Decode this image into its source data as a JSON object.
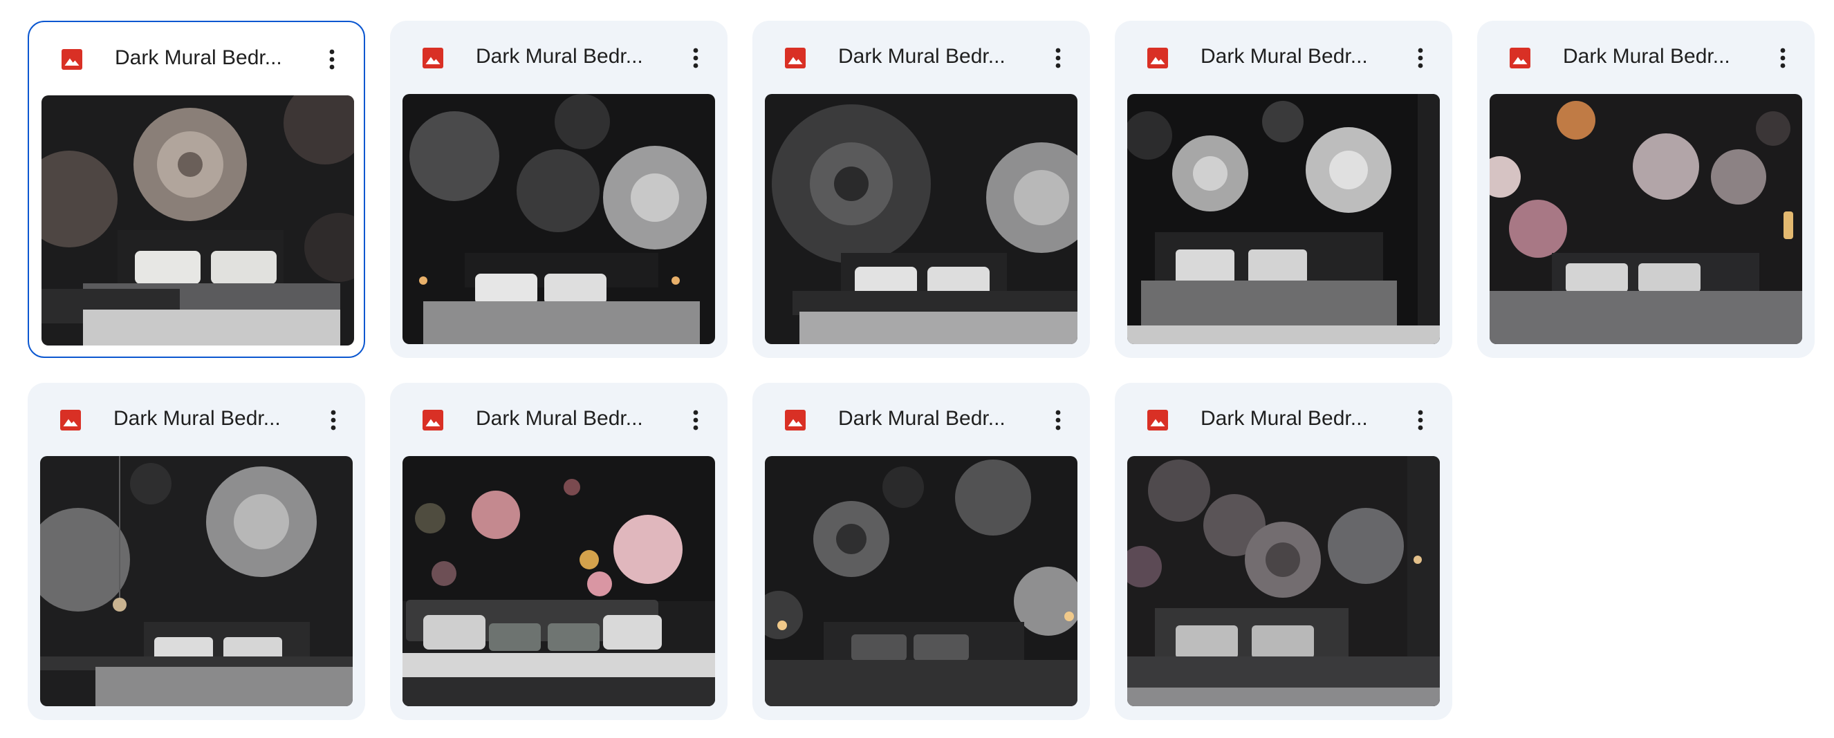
{
  "files": [
    {
      "title": "Dark Mural Bedr...",
      "selected": true
    },
    {
      "title": "Dark Mural Bedr...",
      "selected": false
    },
    {
      "title": "Dark Mural Bedr...",
      "selected": false
    },
    {
      "title": "Dark Mural Bedr...",
      "selected": false
    },
    {
      "title": "Dark Mural Bedr...",
      "selected": false
    },
    {
      "title": "Dark Mural Bedr...",
      "selected": false
    },
    {
      "title": "Dark Mural Bedr...",
      "selected": false
    },
    {
      "title": "Dark Mural Bedr...",
      "selected": false
    },
    {
      "title": "Dark Mural Bedr...",
      "selected": false
    }
  ],
  "icons": {
    "file_type": "image-file-icon",
    "menu": "more-vert-icon"
  },
  "colors": {
    "card_bg": "#f0f4f9",
    "selected_border": "#0b57d0",
    "image_icon": "#d93025",
    "title_text": "#1f1f1f"
  }
}
